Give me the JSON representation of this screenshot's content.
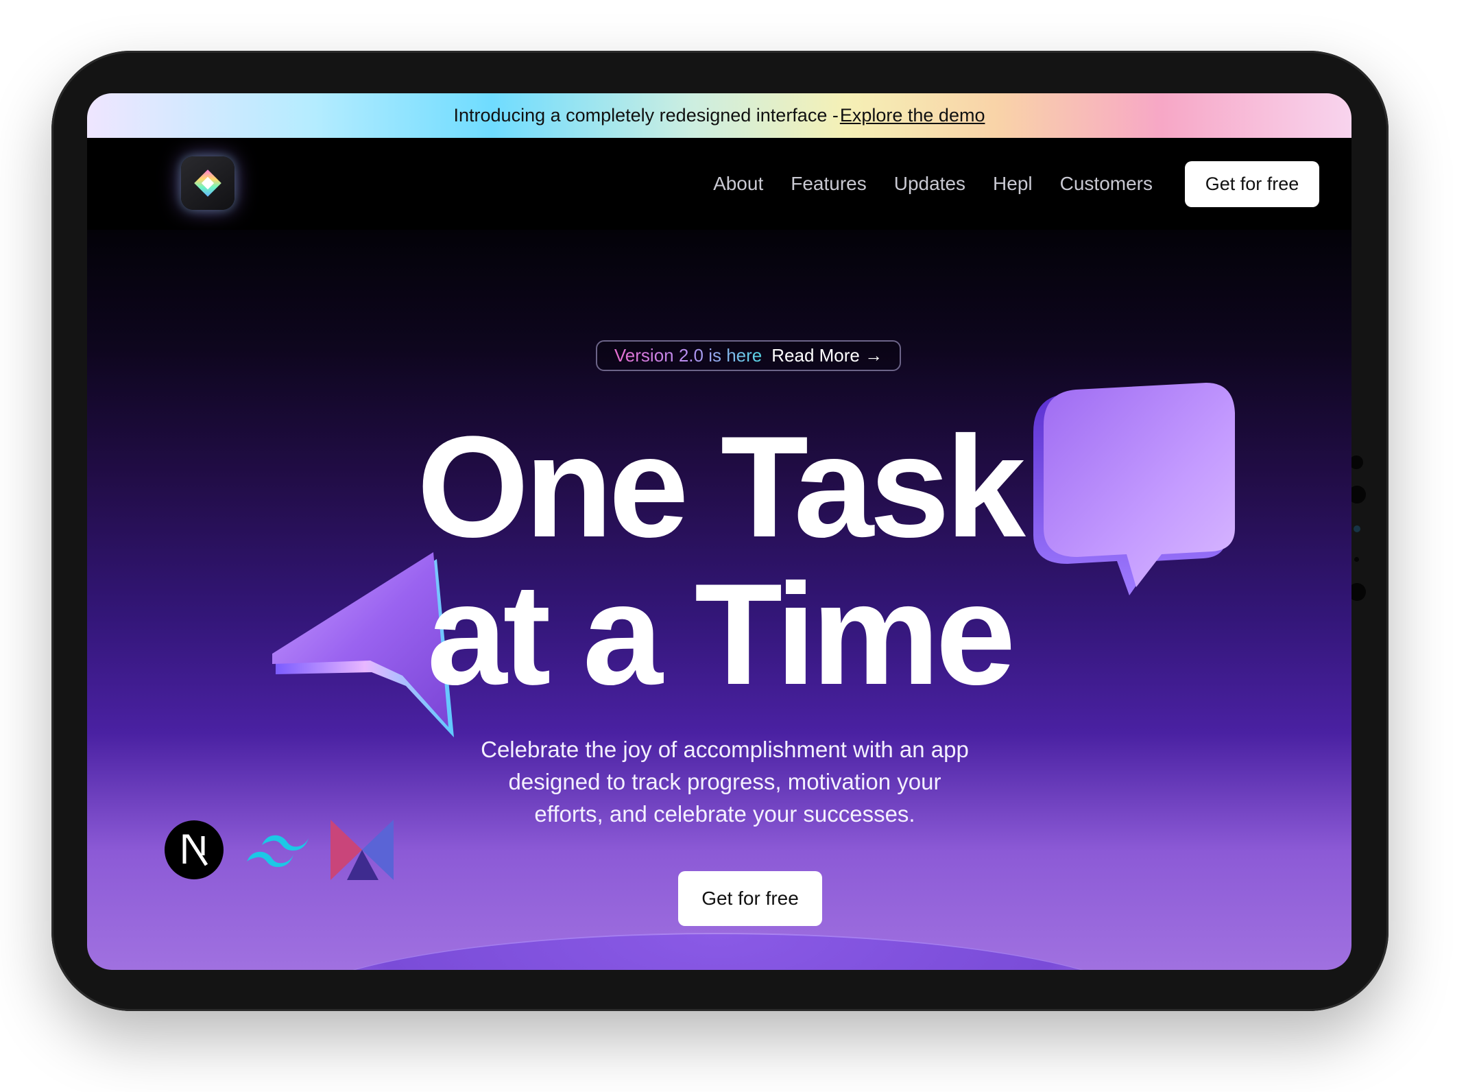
{
  "banner": {
    "text": "Introducing a completely redesigned interface -",
    "link": "Explore the demo"
  },
  "nav": {
    "items": [
      "About",
      "Features",
      "Updates",
      "Hepl",
      "Customers"
    ],
    "cta": "Get for free"
  },
  "hero": {
    "pill_version": "Version 2.0 is here",
    "pill_link": "Read More",
    "pill_arrow": "→",
    "headline_line1": "One Task",
    "headline_line2": "at a Time",
    "subtitle": "Celebrate the joy of accomplishment with an app designed to track progress, motivation your efforts, and celebrate your successes.",
    "cta": "Get for free"
  },
  "tech_logos": [
    "nextjs-icon",
    "tailwind-icon",
    "kotlin-icon"
  ],
  "colors": {
    "hero_top": "#030208",
    "hero_mid": "#331678",
    "hero_bottom": "#a071e0",
    "accent_purple": "#a673f0"
  }
}
